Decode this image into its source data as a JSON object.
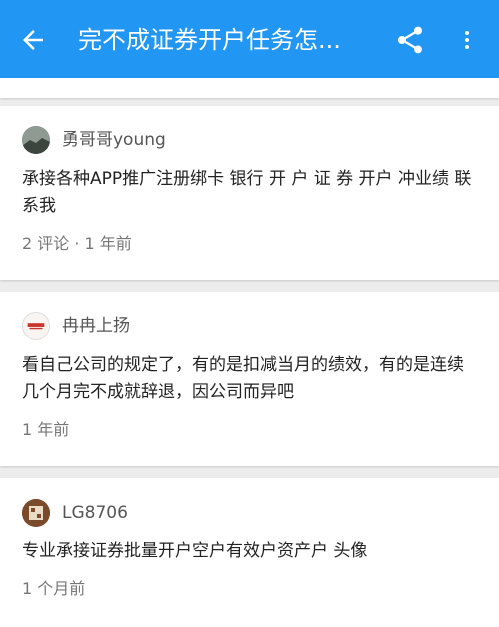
{
  "appbar": {
    "title": "完不成证券开户任务怎...",
    "color": "#2196f3"
  },
  "comments": [
    {
      "username": "勇哥哥young",
      "content": "承接各种APP推广注册绑卡 银行 开 户 证 券 开户 冲业绩 联系我",
      "meta": "2 评论 · 1 年前"
    },
    {
      "username": "冉冉上扬",
      "content": "看自己公司的规定了，有的是扣减当月的绩效，有的是连续几个月完不成就辞退，因公司而异吧",
      "meta": "1 年前"
    },
    {
      "username": "LG8706",
      "content": "专业承接证券批量开户空户有效户资产户 头像",
      "meta": "1 个月前"
    }
  ]
}
